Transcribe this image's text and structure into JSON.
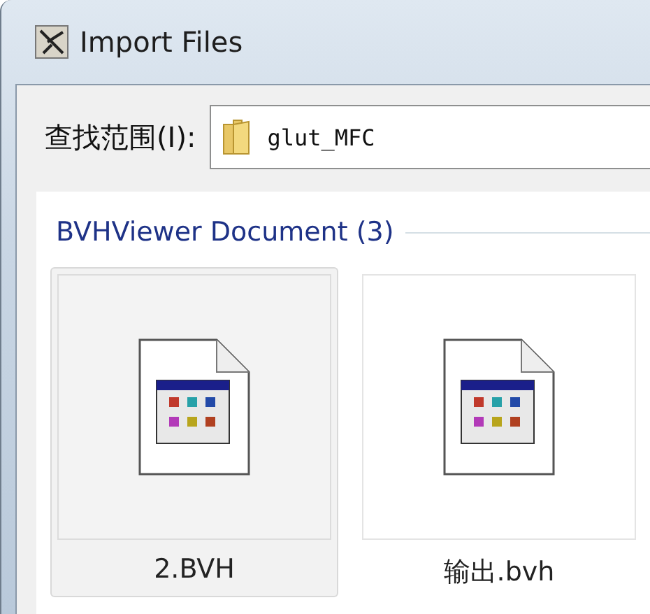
{
  "window": {
    "title": "Import Files"
  },
  "look_in": {
    "label": "查找范围(I):",
    "value": "glut_MFC"
  },
  "group": {
    "title": "BVHViewer Document (3)"
  },
  "files": [
    {
      "name": "2.BVH",
      "selected": true
    },
    {
      "name": "输出.bvh",
      "selected": false
    }
  ]
}
